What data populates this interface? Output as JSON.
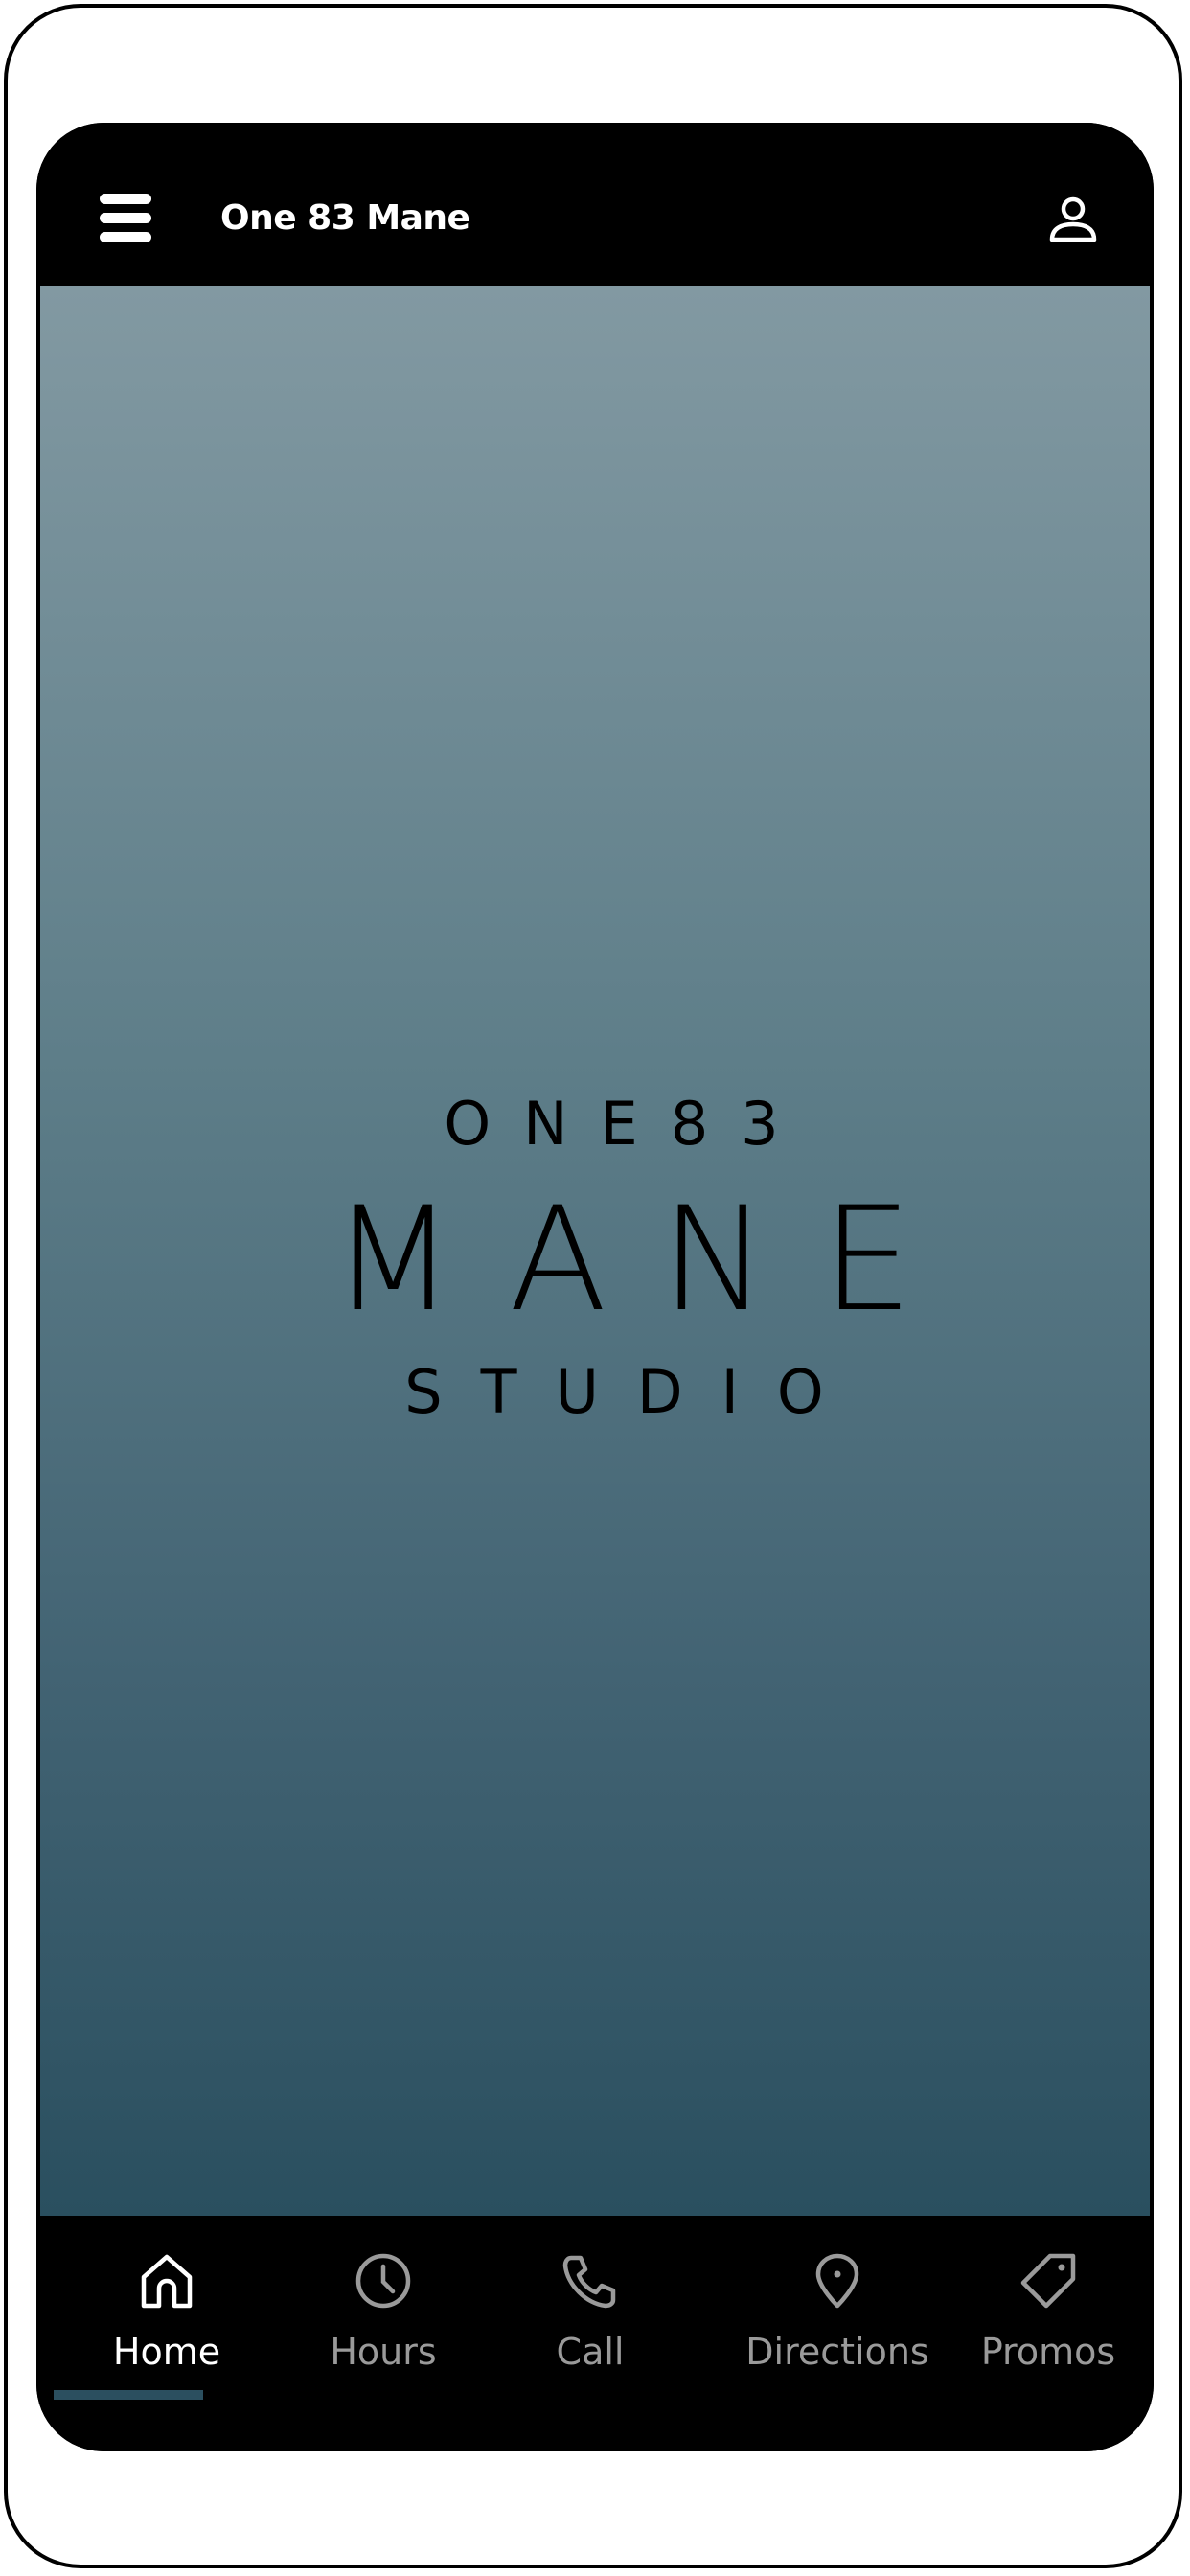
{
  "app": {
    "title": "One 83 Mane"
  },
  "logo": {
    "line1": "ONE83",
    "line2": "MANE",
    "line3": "STUDIO"
  },
  "icons": {
    "menu": "hamburger-menu-icon",
    "profile": "user-profile-icon"
  },
  "bottom_nav": {
    "items": [
      {
        "label": "Home",
        "icon": "home-icon",
        "active": true
      },
      {
        "label": "Hours",
        "icon": "clock-icon",
        "active": false
      },
      {
        "label": "Call",
        "icon": "phone-icon",
        "active": false
      },
      {
        "label": "Directions",
        "icon": "map-pin-icon",
        "active": false
      },
      {
        "label": "Promos",
        "icon": "tag-icon",
        "active": false
      }
    ]
  },
  "colors": {
    "background": "#000000",
    "gradient_top": "#8299a2",
    "gradient_bottom": "#2a4f5f",
    "active_indicator": "#2b4f5f",
    "active_label": "#ffffff",
    "inactive_label": "#9a9a9a"
  }
}
